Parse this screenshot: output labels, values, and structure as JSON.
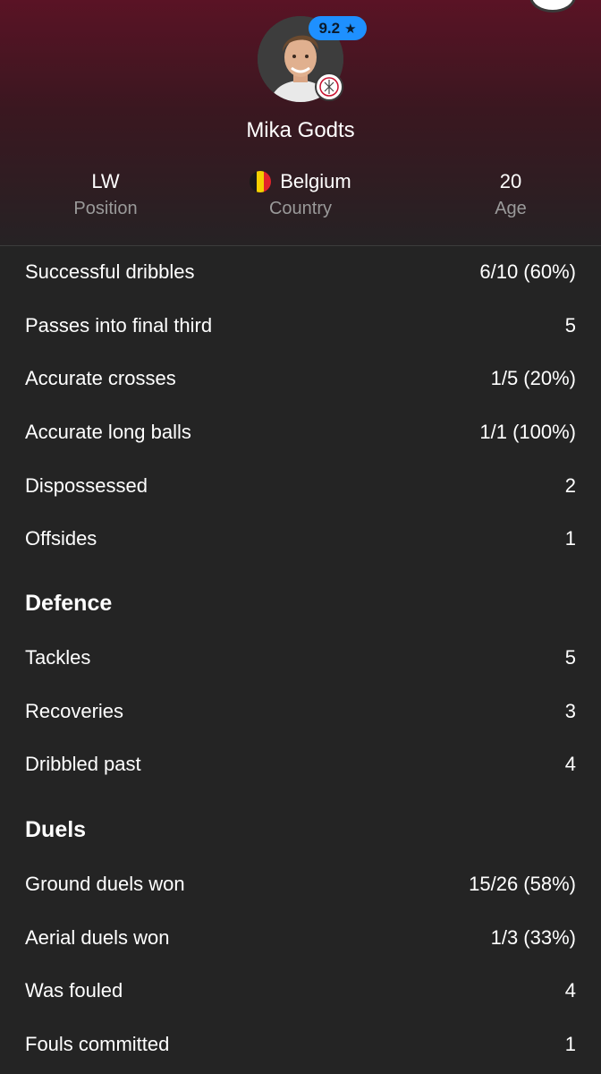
{
  "header": {
    "player_name": "Mika Godts",
    "rating": "9.2",
    "rating_icon": "star-icon",
    "position_value": "LW",
    "position_label": "Position",
    "country_value": "Belgium",
    "country_label": "Country",
    "age_value": "20",
    "age_label": "Age",
    "colors": {
      "rating_badge": "#1e90ff",
      "header_top": "#5a1325"
    }
  },
  "stats": [
    {
      "label": "Successful dribbles",
      "value": "6/10 (60%)"
    },
    {
      "label": "Passes into final third",
      "value": "5"
    },
    {
      "label": "Accurate crosses",
      "value": "1/5 (20%)"
    },
    {
      "label": "Accurate long balls",
      "value": "1/1 (100%)"
    },
    {
      "label": "Dispossessed",
      "value": "2"
    },
    {
      "label": "Offsides",
      "value": "1"
    }
  ],
  "defence": {
    "title": "Defence",
    "rows": [
      {
        "label": "Tackles",
        "value": "5"
      },
      {
        "label": "Recoveries",
        "value": "3"
      },
      {
        "label": "Dribbled past",
        "value": "4"
      }
    ]
  },
  "duels": {
    "title": "Duels",
    "rows": [
      {
        "label": "Ground duels won",
        "value": "15/26 (58%)"
      },
      {
        "label": "Aerial duels won",
        "value": "1/3 (33%)"
      },
      {
        "label": "Was fouled",
        "value": "4"
      },
      {
        "label": "Fouls committed",
        "value": "1"
      }
    ]
  }
}
